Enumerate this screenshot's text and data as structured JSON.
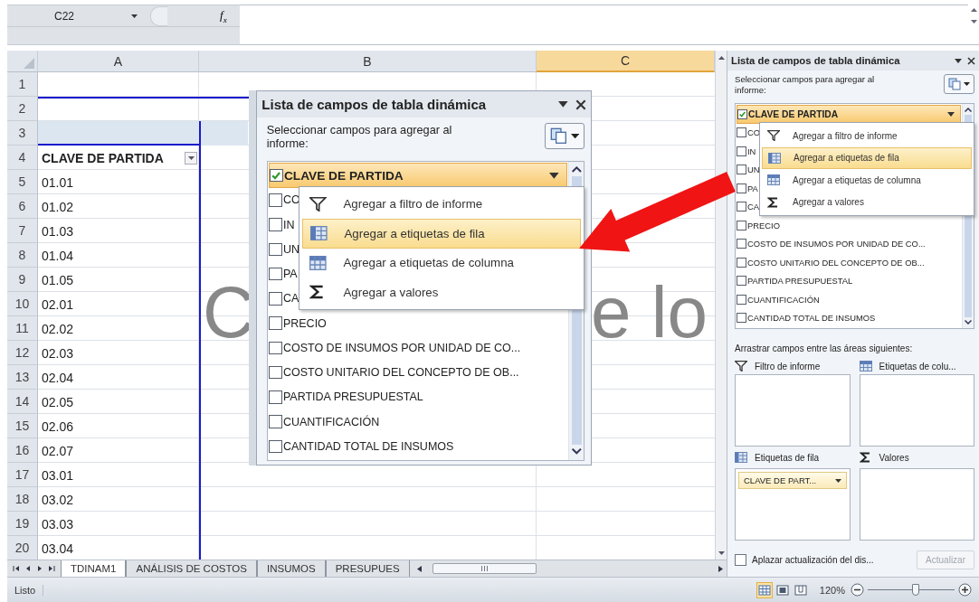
{
  "formula_bar": {
    "name_box": "C22",
    "function_symbol": "f$_{x}$"
  },
  "grid": {
    "columns": [
      {
        "label": "A",
        "selected": false
      },
      {
        "label": "B",
        "selected": false
      },
      {
        "label": "C",
        "selected": true
      }
    ],
    "rows": [
      {
        "number": "1",
        "kind": "blank"
      },
      {
        "number": "2",
        "kind": "blank"
      },
      {
        "number": "3",
        "kind": "blank"
      },
      {
        "number": "4",
        "kind": "header",
        "cell_a": "CLAVE DE PARTIDA"
      },
      {
        "number": "5",
        "kind": "item",
        "cell_a": "01.01"
      },
      {
        "number": "6",
        "kind": "item",
        "cell_a": "01.02"
      },
      {
        "number": "7",
        "kind": "item",
        "cell_a": "01.03"
      },
      {
        "number": "8",
        "kind": "item",
        "cell_a": "01.04"
      },
      {
        "number": "9",
        "kind": "item",
        "cell_a": "01.05"
      },
      {
        "number": "10",
        "kind": "item",
        "cell_a": "02.01"
      },
      {
        "number": "11",
        "kind": "item",
        "cell_a": "02.02"
      },
      {
        "number": "12",
        "kind": "item",
        "cell_a": "02.03"
      },
      {
        "number": "13",
        "kind": "item",
        "cell_a": "02.04"
      },
      {
        "number": "14",
        "kind": "item",
        "cell_a": "02.05"
      },
      {
        "number": "15",
        "kind": "item",
        "cell_a": "02.06"
      },
      {
        "number": "16",
        "kind": "item",
        "cell_a": "02.07"
      },
      {
        "number": "17",
        "kind": "item",
        "cell_a": "03.01"
      },
      {
        "number": "18",
        "kind": "item",
        "cell_a": "03.02"
      },
      {
        "number": "19",
        "kind": "item",
        "cell_a": "03.03"
      },
      {
        "number": "20",
        "kind": "item",
        "cell_a": "03.04"
      }
    ],
    "background_text": [
      "C",
      "e lo"
    ]
  },
  "inset_panel": {
    "title": "Lista de campos de tabla dinámica",
    "instruction": "Seleccionar campos para agregar al informe:",
    "fields": [
      {
        "label": "CLAVE DE PARTIDA",
        "checked": true,
        "selected": true
      },
      {
        "label": "CO",
        "checked": false,
        "selected": false
      },
      {
        "label": "IN",
        "checked": false,
        "selected": false
      },
      {
        "label": "UN",
        "checked": false,
        "selected": false
      },
      {
        "label": "PA",
        "checked": false,
        "selected": false
      },
      {
        "label": "CA",
        "checked": false,
        "selected": false
      },
      {
        "label": "PRECIO",
        "checked": false,
        "selected": false
      },
      {
        "label": "COSTO DE INSUMOS POR UNIDAD DE CO...",
        "checked": false,
        "selected": false
      },
      {
        "label": "COSTO UNITARIO DEL CONCEPTO DE OB...",
        "checked": false,
        "selected": false
      },
      {
        "label": "PARTIDA PRESUPUESTAL",
        "checked": false,
        "selected": false
      },
      {
        "label": "CUANTIFICACIÓN",
        "checked": false,
        "selected": false
      },
      {
        "label": "CANTIDAD TOTAL DE INSUMOS",
        "checked": false,
        "selected": false
      }
    ],
    "menu": [
      {
        "label": "Agregar a filtro de informe",
        "kind": "filter",
        "selected": false
      },
      {
        "label": "Agregar a etiquetas de fila",
        "kind": "rows",
        "selected": true
      },
      {
        "label": "Agregar a etiquetas de columna",
        "kind": "columns",
        "selected": false
      },
      {
        "label": "Agregar a valores",
        "kind": "values",
        "selected": false
      }
    ]
  },
  "task_pane": {
    "title": "Lista de campos de tabla dinámica",
    "instruction": "Seleccionar campos para agregar al informe:",
    "fields": [
      {
        "label": "CLAVE DE PARTIDA",
        "checked": true,
        "selected": true
      },
      {
        "label": "CO",
        "checked": false,
        "selected": false
      },
      {
        "label": "IN",
        "checked": false,
        "selected": false
      },
      {
        "label": "UN",
        "checked": false,
        "selected": false
      },
      {
        "label": "PA",
        "checked": false,
        "selected": false
      },
      {
        "label": "CA",
        "checked": false,
        "selected": false
      },
      {
        "label": "PRECIO",
        "checked": false,
        "selected": false
      },
      {
        "label": "COSTO DE INSUMOS POR UNIDAD DE CO...",
        "checked": false,
        "selected": false
      },
      {
        "label": "COSTO UNITARIO DEL CONCEPTO DE OB...",
        "checked": false,
        "selected": false
      },
      {
        "label": "PARTIDA PRESUPUESTAL",
        "checked": false,
        "selected": false
      },
      {
        "label": "CUANTIFICACIÓN",
        "checked": false,
        "selected": false
      },
      {
        "label": "CANTIDAD TOTAL DE INSUMOS",
        "checked": false,
        "selected": false
      }
    ],
    "menu": [
      {
        "label": "Agregar a filtro de informe",
        "kind": "filter",
        "selected": false
      },
      {
        "label": "Agregar a etiquetas de fila",
        "kind": "rows",
        "selected": true
      },
      {
        "label": "Agregar a etiquetas de columna",
        "kind": "columns",
        "selected": false
      },
      {
        "label": "Agregar a valores",
        "kind": "values",
        "selected": false
      }
    ],
    "areas_instruction": "Arrastrar campos entre las áreas siguientes:",
    "areas": [
      {
        "label": "Filtro de informe",
        "kind": "filter"
      },
      {
        "label": "Etiquetas de colu...",
        "kind": "columns"
      },
      {
        "label": "Etiquetas de fila",
        "kind": "rows",
        "fields": [
          "CLAVE DE PART..."
        ]
      },
      {
        "label": "Valores",
        "kind": "values"
      }
    ],
    "defer_update": {
      "label": "Aplazar actualización del dis...",
      "checked": false
    },
    "update_button": {
      "label": "Actualizar",
      "disabled": true
    }
  },
  "sheet_tabs": [
    {
      "label": "TDINAM1",
      "selected": true
    },
    {
      "label": "ANÁLISIS DE COSTOS",
      "selected": false
    },
    {
      "label": "INSUMOS",
      "selected": false
    },
    {
      "label": "PRESUPUES",
      "selected": false
    }
  ],
  "status_bar": {
    "status": "Listo",
    "views": [
      {
        "kind": "normal",
        "selected": true
      },
      {
        "kind": "page_layout",
        "selected": false
      },
      {
        "kind": "page_break",
        "selected": false
      }
    ],
    "zoom": {
      "text": "120%",
      "level": 0.55
    }
  }
}
